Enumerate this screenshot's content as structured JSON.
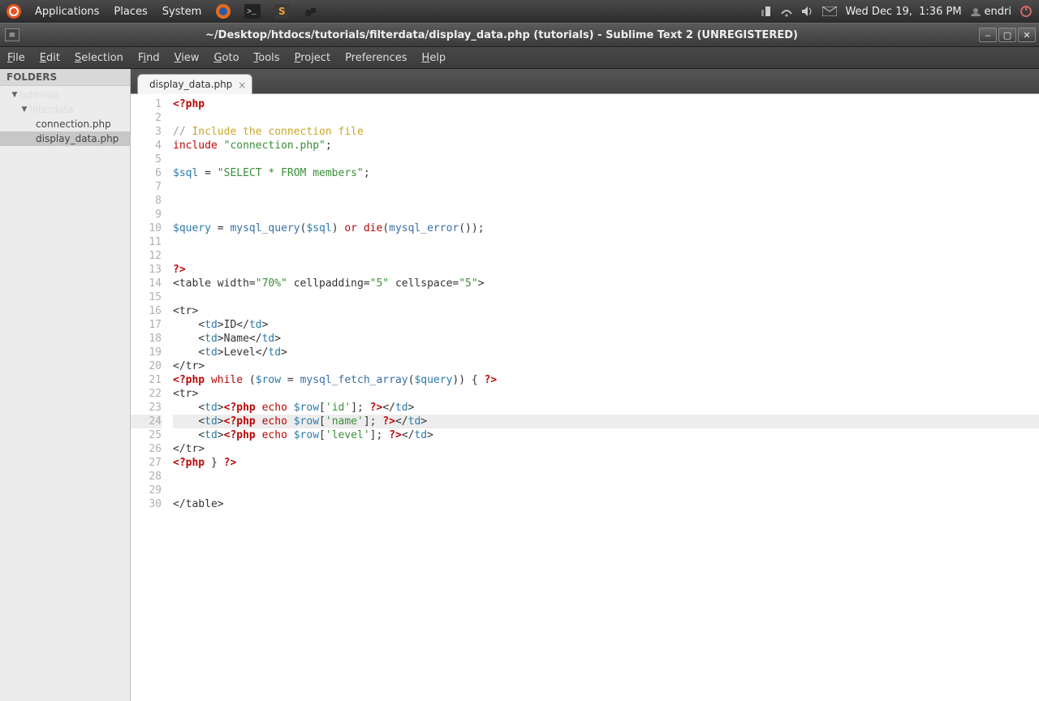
{
  "panel": {
    "applications": "Applications",
    "places": "Places",
    "system": "System",
    "date": "Wed Dec 19,",
    "time": "1:36 PM",
    "user": "endri"
  },
  "titlebar": {
    "title": "~/Desktop/htdocs/tutorials/filterdata/display_data.php (tutorials) - Sublime Text 2 (UNREGISTERED)"
  },
  "menu": {
    "file": "File",
    "edit": "Edit",
    "selection": "Selection",
    "find": "Find",
    "view": "View",
    "goto": "Goto",
    "tools": "Tools",
    "project": "Project",
    "preferences": "Preferences",
    "help": "Help"
  },
  "sidebar": {
    "header": "FOLDERS",
    "root": "tutorials",
    "folder1": "filterdata",
    "files": [
      "connection.php",
      "display_data.php"
    ],
    "selected": "display_data.php"
  },
  "tab": {
    "label": "display_data.php"
  },
  "code": {
    "lines": [
      {
        "n": 1,
        "tokens": [
          {
            "t": "<?php",
            "c": "c-kw"
          }
        ]
      },
      {
        "n": 2,
        "tokens": []
      },
      {
        "n": 3,
        "tokens": [
          {
            "t": "// ",
            "c": "c-com"
          },
          {
            "t": "Include the connection file",
            "c": "c-com2"
          }
        ]
      },
      {
        "n": 4,
        "tokens": [
          {
            "t": "include",
            "c": "c-inc"
          },
          {
            "t": " "
          },
          {
            "t": "\"connection.php\"",
            "c": "c-str"
          },
          {
            "t": ";"
          }
        ]
      },
      {
        "n": 5,
        "tokens": []
      },
      {
        "n": 6,
        "tokens": [
          {
            "t": "$sql",
            "c": "c-var"
          },
          {
            "t": " = "
          },
          {
            "t": "\"SELECT * FROM members\"",
            "c": "c-str"
          },
          {
            "t": ";"
          }
        ]
      },
      {
        "n": 7,
        "tokens": []
      },
      {
        "n": 8,
        "tokens": []
      },
      {
        "n": 9,
        "tokens": []
      },
      {
        "n": 10,
        "tokens": [
          {
            "t": "$query",
            "c": "c-var"
          },
          {
            "t": " = "
          },
          {
            "t": "mysql_query",
            "c": "c-func"
          },
          {
            "t": "("
          },
          {
            "t": "$sql",
            "c": "c-var"
          },
          {
            "t": ") "
          },
          {
            "t": "or",
            "c": "c-func2"
          },
          {
            "t": " "
          },
          {
            "t": "die",
            "c": "c-func2"
          },
          {
            "t": "("
          },
          {
            "t": "mysql_error",
            "c": "c-func"
          },
          {
            "t": "());"
          }
        ]
      },
      {
        "n": 11,
        "tokens": []
      },
      {
        "n": 12,
        "tokens": []
      },
      {
        "n": 13,
        "tokens": [
          {
            "t": "?>",
            "c": "c-kw"
          }
        ]
      },
      {
        "n": 14,
        "tokens": [
          {
            "t": "<table width=",
            "c": ""
          },
          {
            "t": "\"70%\"",
            "c": "c-str"
          },
          {
            "t": " cellpadding="
          },
          {
            "t": "\"5\"",
            "c": "c-str"
          },
          {
            "t": " cellspace="
          },
          {
            "t": "\"5\"",
            "c": "c-str"
          },
          {
            "t": ">"
          }
        ]
      },
      {
        "n": 15,
        "tokens": []
      },
      {
        "n": 16,
        "tokens": [
          {
            "t": "<tr>"
          }
        ]
      },
      {
        "n": 17,
        "tokens": [
          {
            "t": "    <"
          },
          {
            "t": "td",
            "c": "c-html"
          },
          {
            "t": ">ID</"
          },
          {
            "t": "td",
            "c": "c-html"
          },
          {
            "t": ">"
          }
        ]
      },
      {
        "n": 18,
        "tokens": [
          {
            "t": "    <"
          },
          {
            "t": "td",
            "c": "c-html"
          },
          {
            "t": ">Name</"
          },
          {
            "t": "td",
            "c": "c-html"
          },
          {
            "t": ">"
          }
        ]
      },
      {
        "n": 19,
        "tokens": [
          {
            "t": "    <"
          },
          {
            "t": "td",
            "c": "c-html"
          },
          {
            "t": ">Level</"
          },
          {
            "t": "td",
            "c": "c-html"
          },
          {
            "t": ">"
          }
        ]
      },
      {
        "n": 20,
        "tokens": [
          {
            "t": "</tr>"
          }
        ]
      },
      {
        "n": 21,
        "tokens": [
          {
            "t": "<?php",
            "c": "c-kw"
          },
          {
            "t": " "
          },
          {
            "t": "while",
            "c": "c-while"
          },
          {
            "t": " ("
          },
          {
            "t": "$row",
            "c": "c-var"
          },
          {
            "t": " = "
          },
          {
            "t": "mysql_fetch_array",
            "c": "c-func"
          },
          {
            "t": "("
          },
          {
            "t": "$query",
            "c": "c-var"
          },
          {
            "t": ")) { "
          },
          {
            "t": "?>",
            "c": "c-kw"
          }
        ]
      },
      {
        "n": 22,
        "tokens": [
          {
            "t": "<tr>"
          }
        ]
      },
      {
        "n": 23,
        "tokens": [
          {
            "t": "    <"
          },
          {
            "t": "td",
            "c": "c-html"
          },
          {
            "t": ">"
          },
          {
            "t": "<?php",
            "c": "c-kw"
          },
          {
            "t": " "
          },
          {
            "t": "echo",
            "c": "c-func2"
          },
          {
            "t": " "
          },
          {
            "t": "$row",
            "c": "c-var"
          },
          {
            "t": "["
          },
          {
            "t": "'id'",
            "c": "c-str"
          },
          {
            "t": "]; "
          },
          {
            "t": "?>",
            "c": "c-kw"
          },
          {
            "t": "</"
          },
          {
            "t": "td",
            "c": "c-html"
          },
          {
            "t": ">"
          }
        ]
      },
      {
        "n": 24,
        "hl": true,
        "tokens": [
          {
            "t": "    <"
          },
          {
            "t": "td",
            "c": "c-html"
          },
          {
            "t": ">"
          },
          {
            "t": "<?php",
            "c": "c-kw"
          },
          {
            "t": " "
          },
          {
            "t": "echo",
            "c": "c-func2"
          },
          {
            "t": " "
          },
          {
            "t": "$row",
            "c": "c-var"
          },
          {
            "t": "["
          },
          {
            "t": "'name'",
            "c": "c-str"
          },
          {
            "t": "]; "
          },
          {
            "t": "?>",
            "c": "c-kw"
          },
          {
            "t": "</"
          },
          {
            "t": "td",
            "c": "c-html"
          },
          {
            "t": ">"
          }
        ]
      },
      {
        "n": 25,
        "tokens": [
          {
            "t": "    <"
          },
          {
            "t": "td",
            "c": "c-html"
          },
          {
            "t": ">"
          },
          {
            "t": "<?php",
            "c": "c-kw"
          },
          {
            "t": " "
          },
          {
            "t": "echo",
            "c": "c-func2"
          },
          {
            "t": " "
          },
          {
            "t": "$row",
            "c": "c-var"
          },
          {
            "t": "["
          },
          {
            "t": "'level'",
            "c": "c-str"
          },
          {
            "t": "]; "
          },
          {
            "t": "?>",
            "c": "c-kw"
          },
          {
            "t": "</"
          },
          {
            "t": "td",
            "c": "c-html"
          },
          {
            "t": ">"
          }
        ]
      },
      {
        "n": 26,
        "tokens": [
          {
            "t": "</tr>"
          }
        ]
      },
      {
        "n": 27,
        "tokens": [
          {
            "t": "<?php",
            "c": "c-kw"
          },
          {
            "t": " } "
          },
          {
            "t": "?>",
            "c": "c-kw"
          }
        ]
      },
      {
        "n": 28,
        "tokens": []
      },
      {
        "n": 29,
        "tokens": []
      },
      {
        "n": 30,
        "tokens": [
          {
            "t": "</table>"
          }
        ]
      }
    ],
    "cursor_line": 19,
    "cursor_after_token_text": "<td>"
  }
}
